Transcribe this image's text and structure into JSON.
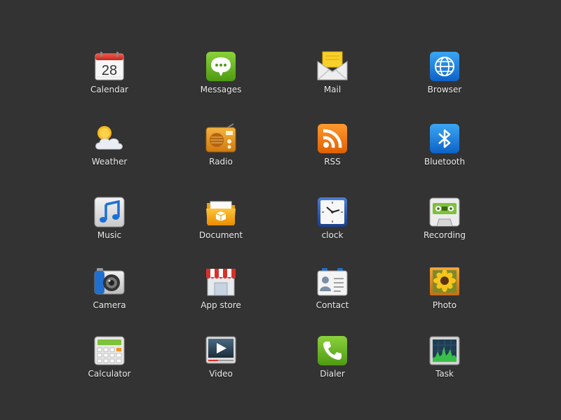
{
  "launcher": {
    "apps": [
      {
        "label": "Calendar",
        "day": "28",
        "icon": "calendar-icon"
      },
      {
        "label": "Messages",
        "icon": "chat-bubble-icon"
      },
      {
        "label": "Mail",
        "icon": "envelope-icon"
      },
      {
        "label": "Browser",
        "icon": "globe-icon"
      },
      {
        "label": "Weather",
        "icon": "sun-cloud-icon"
      },
      {
        "label": "Radio",
        "icon": "radio-icon"
      },
      {
        "label": "RSS",
        "icon": "rss-icon"
      },
      {
        "label": "Bluetooth",
        "icon": "bluetooth-icon"
      },
      {
        "label": "Music",
        "icon": "music-note-icon"
      },
      {
        "label": "Document",
        "icon": "folder-icon"
      },
      {
        "label": "clock",
        "icon": "clock-icon"
      },
      {
        "label": "Recording",
        "icon": "cassette-icon"
      },
      {
        "label": "Camera",
        "icon": "camera-icon"
      },
      {
        "label": "App store",
        "icon": "storefront-icon"
      },
      {
        "label": "Contact",
        "icon": "contact-card-icon"
      },
      {
        "label": "Photo",
        "icon": "sunflower-photo-icon"
      },
      {
        "label": "Calculator",
        "icon": "calculator-icon"
      },
      {
        "label": "Video",
        "icon": "play-screen-icon"
      },
      {
        "label": "Dialer",
        "icon": "phone-icon"
      },
      {
        "label": "Task",
        "icon": "monitor-graph-icon"
      }
    ]
  }
}
